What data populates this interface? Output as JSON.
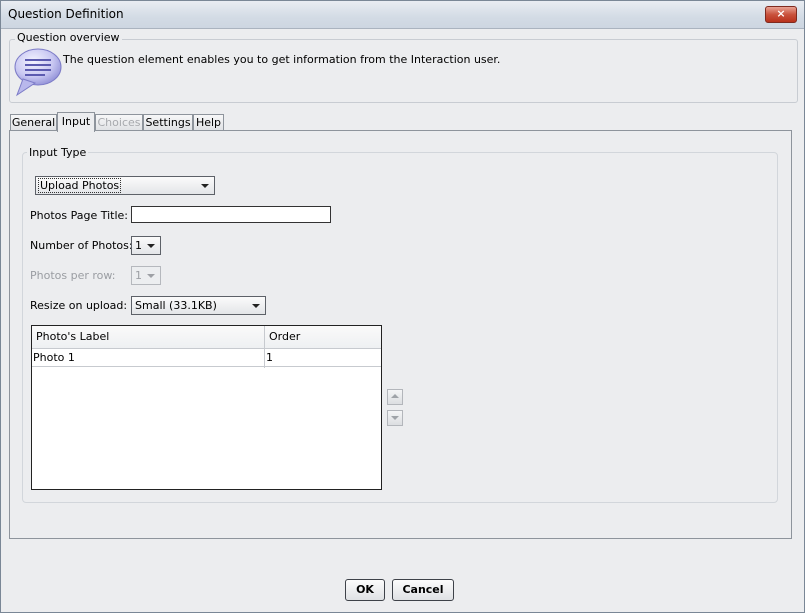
{
  "window": {
    "title": "Question Definition",
    "close_label": "×"
  },
  "overview": {
    "legend": "Question overview",
    "description": "The question element enables you to get information from the Interaction user."
  },
  "tabs": [
    {
      "label": "General",
      "active": false,
      "enabled": true
    },
    {
      "label": "Input",
      "active": true,
      "enabled": true
    },
    {
      "label": "Choices",
      "active": false,
      "enabled": false
    },
    {
      "label": "Settings",
      "active": false,
      "enabled": true
    },
    {
      "label": "Help",
      "active": false,
      "enabled": true
    }
  ],
  "input_type": {
    "legend": "Input Type",
    "selected": "Upload Photos"
  },
  "fields": {
    "page_title_label": "Photos Page Title:",
    "page_title_value": "",
    "num_photos_label": "Number of Photos:",
    "num_photos_value": "1",
    "per_row_label": "Photos per row:",
    "per_row_value": "1",
    "resize_label": "Resize on upload:",
    "resize_value": "Small (33.1KB)"
  },
  "photo_table": {
    "columns": [
      "Photo's Label",
      "Order"
    ],
    "rows": [
      [
        "Photo 1",
        "1"
      ]
    ]
  },
  "buttons": {
    "ok": "OK",
    "cancel": "Cancel"
  }
}
